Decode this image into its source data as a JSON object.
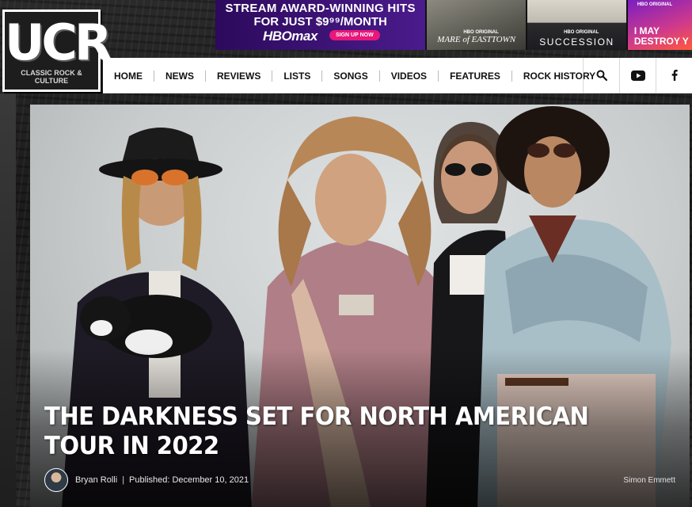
{
  "ad": {
    "line1": "STREAM AWARD-WINNING HITS",
    "line2": "FOR JUST $9⁹⁹/MONTH",
    "brand": "HBOmax",
    "signup": "SIGN UP NOW",
    "tiles": [
      {
        "tag": "HBO ORIGINAL",
        "title": "MARE of EASTTOWN"
      },
      {
        "tag": "HBO ORIGINAL",
        "title": "SUCCESSION"
      },
      {
        "tag": "HBO ORIGINAL",
        "title": "I MAY DESTROY Y"
      }
    ]
  },
  "logo": {
    "text": "UCR",
    "subtitle": "CLASSIC ROCK & CULTURE"
  },
  "nav": {
    "items": [
      "HOME",
      "NEWS",
      "REVIEWS",
      "LISTS",
      "SONGS",
      "VIDEOS",
      "FEATURES",
      "ROCK HISTORY"
    ],
    "icons": [
      "search-icon",
      "youtube-icon",
      "facebook-icon"
    ]
  },
  "article": {
    "headline": "THE DARKNESS SET FOR NORTH AMERICAN TOUR IN 2022",
    "author": "Bryan Rolli",
    "published": "Published: December 10, 2021",
    "photo_credit": "Simon Emmett"
  }
}
